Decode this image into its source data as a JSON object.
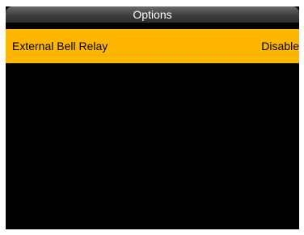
{
  "header": {
    "title": "Options"
  },
  "options": {
    "items": [
      {
        "label": "External Bell Relay",
        "value": "Disable"
      }
    ]
  },
  "colors": {
    "selected_row": "#ffb600",
    "screen_background": "#000000",
    "title_text": "#ffffff"
  }
}
